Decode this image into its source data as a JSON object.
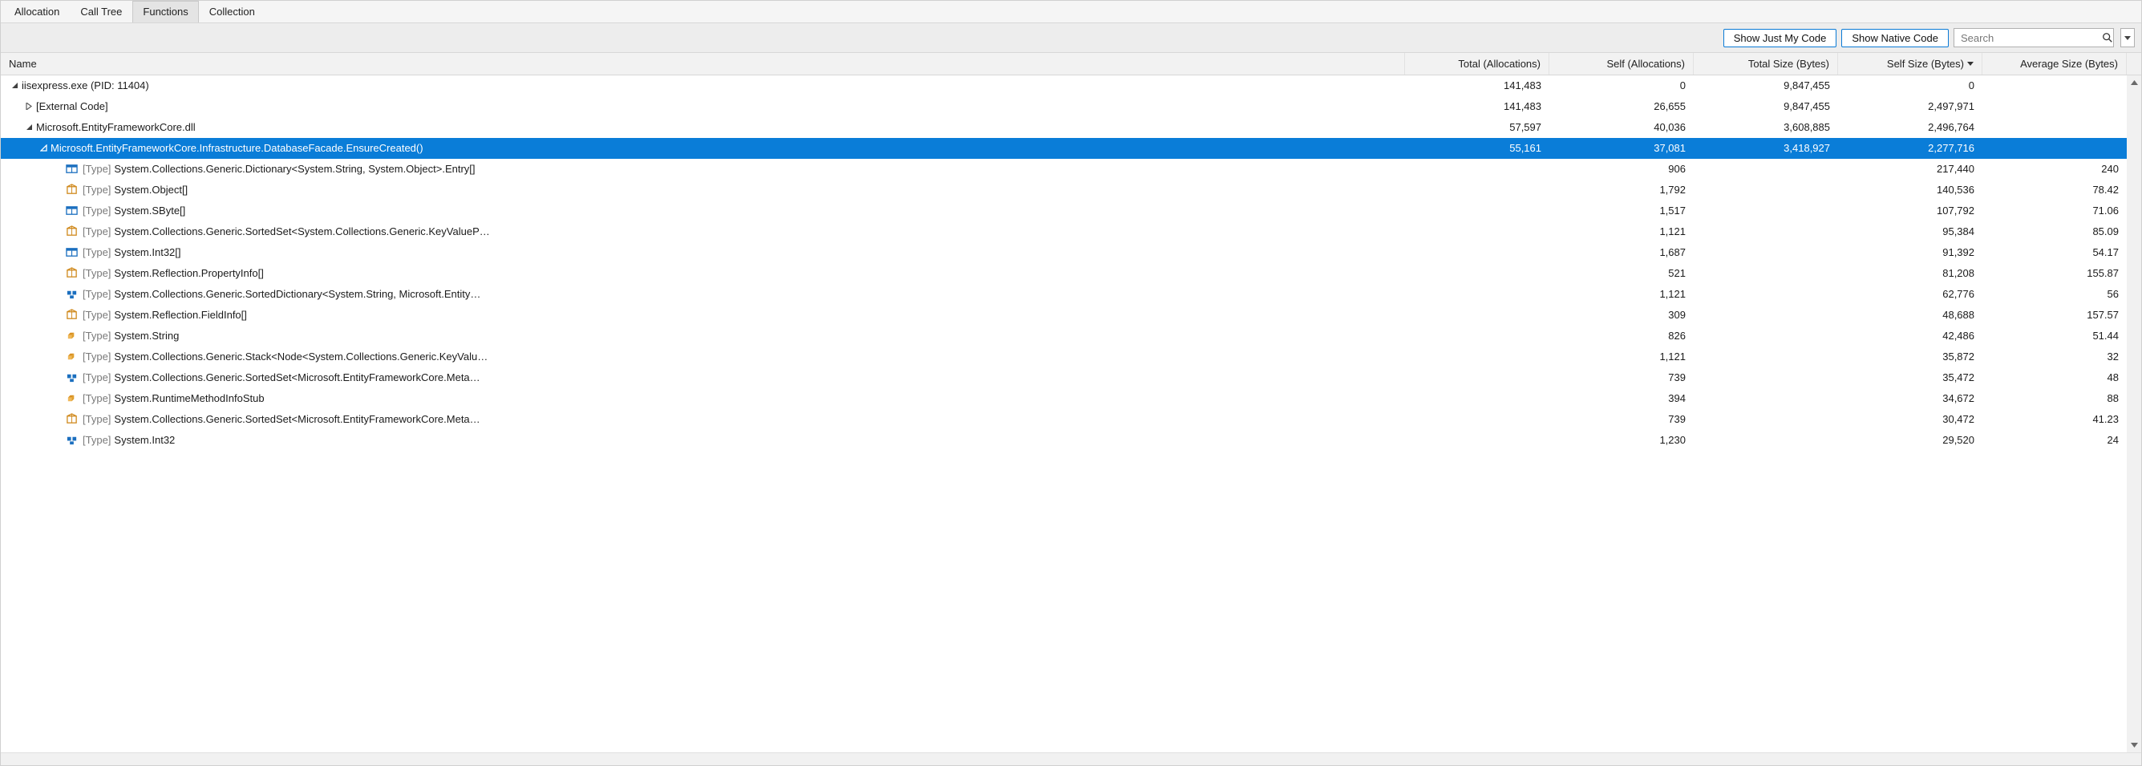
{
  "tabs": [
    {
      "id": "allocation",
      "label": "Allocation",
      "active": false
    },
    {
      "id": "calltree",
      "label": "Call Tree",
      "active": false
    },
    {
      "id": "functions",
      "label": "Functions",
      "active": true
    },
    {
      "id": "collection",
      "label": "Collection",
      "active": false
    }
  ],
  "toolbar": {
    "show_my_code": "Show Just My Code",
    "show_native": "Show Native Code",
    "search_placeholder": "Search"
  },
  "columns": {
    "name": "Name",
    "total_alloc": "Total (Allocations)",
    "self_alloc": "Self (Allocations)",
    "total_size": "Total Size (Bytes)",
    "self_size": "Self Size (Bytes)",
    "avg_size": "Average Size (Bytes)",
    "sorted_col": "self_size"
  },
  "type_prefix": "[Type]",
  "rows": [
    {
      "indent": 0,
      "expander": "open",
      "icon": "none",
      "name": "iisexpress.exe (PID: 11404)",
      "total_alloc": "141,483",
      "self_alloc": "0",
      "total_size": "9,847,455",
      "self_size": "0",
      "avg_size": "",
      "selected": false,
      "is_type": false
    },
    {
      "indent": 1,
      "expander": "closed",
      "icon": "none",
      "name": "[External Code]",
      "total_alloc": "141,483",
      "self_alloc": "26,655",
      "total_size": "9,847,455",
      "self_size": "2,497,971",
      "avg_size": "",
      "selected": false,
      "is_type": false
    },
    {
      "indent": 1,
      "expander": "open",
      "icon": "none",
      "name": "Microsoft.EntityFrameworkCore.dll",
      "total_alloc": "57,597",
      "self_alloc": "40,036",
      "total_size": "3,608,885",
      "self_size": "2,496,764",
      "avg_size": "",
      "selected": false,
      "is_type": false
    },
    {
      "indent": 2,
      "expander": "open-sel",
      "icon": "none",
      "name": "Microsoft.EntityFrameworkCore.Infrastructure.DatabaseFacade.EnsureCreated()",
      "total_alloc": "55,161",
      "self_alloc": "37,081",
      "total_size": "3,418,927",
      "self_size": "2,277,716",
      "avg_size": "",
      "selected": true,
      "is_type": false
    },
    {
      "indent": 3,
      "expander": "none",
      "icon": "struct",
      "name": "System.Collections.Generic.Dictionary<System.String, System.Object>.Entry[]",
      "total_alloc": "",
      "self_alloc": "906",
      "total_size": "",
      "self_size": "217,440",
      "avg_size": "240",
      "selected": false,
      "is_type": true
    },
    {
      "indent": 3,
      "expander": "none",
      "icon": "box",
      "name": "System.Object[]",
      "total_alloc": "",
      "self_alloc": "1,792",
      "total_size": "",
      "self_size": "140,536",
      "avg_size": "78.42",
      "selected": false,
      "is_type": true
    },
    {
      "indent": 3,
      "expander": "none",
      "icon": "struct",
      "name": "System.SByte[]",
      "total_alloc": "",
      "self_alloc": "1,517",
      "total_size": "",
      "self_size": "107,792",
      "avg_size": "71.06",
      "selected": false,
      "is_type": true
    },
    {
      "indent": 3,
      "expander": "none",
      "icon": "box",
      "name": "System.Collections.Generic.SortedSet<System.Collections.Generic.KeyValueP…",
      "total_alloc": "",
      "self_alloc": "1,121",
      "total_size": "",
      "self_size": "95,384",
      "avg_size": "85.09",
      "selected": false,
      "is_type": true
    },
    {
      "indent": 3,
      "expander": "none",
      "icon": "struct",
      "name": "System.Int32[]",
      "total_alloc": "",
      "self_alloc": "1,687",
      "total_size": "",
      "self_size": "91,392",
      "avg_size": "54.17",
      "selected": false,
      "is_type": true
    },
    {
      "indent": 3,
      "expander": "none",
      "icon": "box",
      "name": "System.Reflection.PropertyInfo[]",
      "total_alloc": "",
      "self_alloc": "521",
      "total_size": "",
      "self_size": "81,208",
      "avg_size": "155.87",
      "selected": false,
      "is_type": true
    },
    {
      "indent": 3,
      "expander": "none",
      "icon": "class-blue",
      "name": "System.Collections.Generic.SortedDictionary<System.String, Microsoft.Entity…",
      "total_alloc": "",
      "self_alloc": "1,121",
      "total_size": "",
      "self_size": "62,776",
      "avg_size": "56",
      "selected": false,
      "is_type": true
    },
    {
      "indent": 3,
      "expander": "none",
      "icon": "box",
      "name": "System.Reflection.FieldInfo[]",
      "total_alloc": "",
      "self_alloc": "309",
      "total_size": "",
      "self_size": "48,688",
      "avg_size": "157.57",
      "selected": false,
      "is_type": true
    },
    {
      "indent": 3,
      "expander": "none",
      "icon": "class",
      "name": "System.String",
      "total_alloc": "",
      "self_alloc": "826",
      "total_size": "",
      "self_size": "42,486",
      "avg_size": "51.44",
      "selected": false,
      "is_type": true
    },
    {
      "indent": 3,
      "expander": "none",
      "icon": "class",
      "name": "System.Collections.Generic.Stack<Node<System.Collections.Generic.KeyValu…",
      "total_alloc": "",
      "self_alloc": "1,121",
      "total_size": "",
      "self_size": "35,872",
      "avg_size": "32",
      "selected": false,
      "is_type": true
    },
    {
      "indent": 3,
      "expander": "none",
      "icon": "class-blue",
      "name": "System.Collections.Generic.SortedSet<Microsoft.EntityFrameworkCore.Meta…",
      "total_alloc": "",
      "self_alloc": "739",
      "total_size": "",
      "self_size": "35,472",
      "avg_size": "48",
      "selected": false,
      "is_type": true
    },
    {
      "indent": 3,
      "expander": "none",
      "icon": "class",
      "name": "System.RuntimeMethodInfoStub",
      "total_alloc": "",
      "self_alloc": "394",
      "total_size": "",
      "self_size": "34,672",
      "avg_size": "88",
      "selected": false,
      "is_type": true
    },
    {
      "indent": 3,
      "expander": "none",
      "icon": "box",
      "name": "System.Collections.Generic.SortedSet<Microsoft.EntityFrameworkCore.Meta…",
      "total_alloc": "",
      "self_alloc": "739",
      "total_size": "",
      "self_size": "30,472",
      "avg_size": "41.23",
      "selected": false,
      "is_type": true
    },
    {
      "indent": 3,
      "expander": "none",
      "icon": "class-blue",
      "name": "System.Int32",
      "total_alloc": "",
      "self_alloc": "1,230",
      "total_size": "",
      "self_size": "29,520",
      "avg_size": "24",
      "selected": false,
      "is_type": true
    }
  ],
  "icons": {
    "struct": "struct-icon",
    "box": "box-icon",
    "class": "class-icon",
    "class-blue": "class-blue-icon"
  }
}
